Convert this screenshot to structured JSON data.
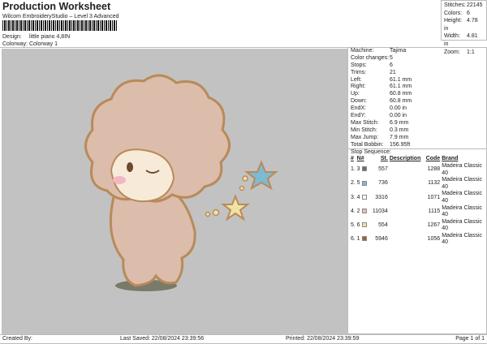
{
  "header": {
    "title": "Production Worksheet",
    "subtitle": "Wilcom EmbroideryStudio – Level 3 Advanced",
    "design_label": "Design:",
    "design": "little piano 4,8IN",
    "colorway_label": "Colorway:",
    "colorway": "Colorway 1"
  },
  "stats": [
    {
      "label": "Stitches:",
      "value": "22145"
    },
    {
      "label": "Colors:",
      "value": "6"
    },
    {
      "label": "Height:",
      "value": "4.78 in"
    },
    {
      "label": "Width:",
      "value": "4.81 in"
    },
    {
      "label": "Zoom:",
      "value": "1:1"
    }
  ],
  "info": [
    {
      "label": "Machine:",
      "value": "Tajima"
    },
    {
      "label": "Color changes:",
      "value": "5"
    },
    {
      "label": "Stops:",
      "value": "6"
    },
    {
      "label": "Trims:",
      "value": "21"
    },
    {
      "label": "Left:",
      "value": "61.1 mm"
    },
    {
      "label": "Right:",
      "value": "61.1 mm"
    },
    {
      "label": "Up:",
      "value": "60.8 mm"
    },
    {
      "label": "Down:",
      "value": "60.8 mm"
    },
    {
      "label": "EndX:",
      "value": "0.00 in"
    },
    {
      "label": "EndY:",
      "value": "0.00 in"
    },
    {
      "label": "Max Stitch:",
      "value": "6.9 mm"
    },
    {
      "label": "Min Stitch:",
      "value": "0.3 mm"
    },
    {
      "label": "Max Jump:",
      "value": "7.9 mm"
    },
    {
      "label": "Total Bobbin:",
      "value": "156.95ft"
    }
  ],
  "stop_sequence": {
    "title": "Stop Sequence:",
    "headers": [
      "#",
      "N#",
      "St.",
      "Description",
      "Code",
      "Brand"
    ],
    "rows": [
      {
        "num": "1.",
        "n": "3",
        "color": "#6e6e6e",
        "st": "557",
        "desc": "",
        "code": "1288",
        "brand": "Madeira Classic 40"
      },
      {
        "num": "2.",
        "n": "5",
        "color": "#7ebad2",
        "st": "736",
        "desc": "",
        "code": "1132",
        "brand": "Madeira Classic 40"
      },
      {
        "num": "3.",
        "n": "4",
        "color": "#ffffff",
        "st": "3316",
        "desc": "",
        "code": "1071",
        "brand": "Madeira Classic 40"
      },
      {
        "num": "4.",
        "n": "2",
        "color": "#f2b8c2",
        "st": "11034",
        "desc": "",
        "code": "1115",
        "brand": "Madeira Classic 40"
      },
      {
        "num": "5.",
        "n": "6",
        "color": "#f0e2a2",
        "st": "554",
        "desc": "",
        "code": "1267",
        "brand": "Madeira Classic 40"
      },
      {
        "num": "6.",
        "n": "1",
        "color": "#a3603a",
        "st": "5946",
        "desc": "",
        "code": "1056",
        "brand": "Madeira Classic 40"
      }
    ]
  },
  "footer": {
    "created": "Created By:",
    "saved": "Last Saved: 22/08/2024 23:39:56",
    "printed": "Printed: 22/08/2024 23:39:59",
    "page": "Page 1 of 1"
  }
}
